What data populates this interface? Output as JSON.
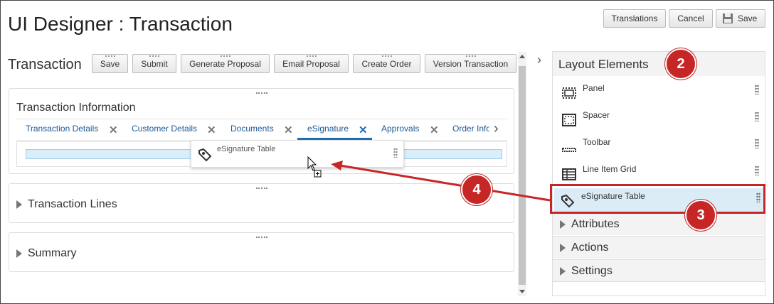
{
  "app": {
    "title": "UI Designer : Transaction"
  },
  "header_buttons": {
    "translations": "Translations",
    "cancel": "Cancel",
    "save": "Save"
  },
  "canvas": {
    "heading": "Transaction",
    "toolbar": [
      "Save",
      "Submit",
      "Generate Proposal",
      "Email Proposal",
      "Create Order",
      "Version Transaction"
    ]
  },
  "transaction_info": {
    "title": "Transaction Information",
    "tabs": [
      "Transaction Details",
      "Customer Details",
      "Documents",
      "eSignature",
      "Approvals",
      "Order Info"
    ],
    "active_tab": "eSignature"
  },
  "drag_ghost": {
    "label": "eSignature Table"
  },
  "sections": {
    "lines": "Transaction Lines",
    "summary": "Summary"
  },
  "layout_elements": {
    "title": "Layout Elements",
    "items": [
      "Panel",
      "Spacer",
      "Toolbar",
      "Line Item Grid",
      "eSignature Table"
    ],
    "selected": "eSignature Table"
  },
  "accordions": [
    "Attributes",
    "Actions",
    "Settings"
  ],
  "callouts": [
    "2",
    "3",
    "4"
  ],
  "colors": {
    "callout": "#c62626",
    "link": "#1e5a96",
    "active_tab_underline": "#1e6fb6",
    "drop_highlight": "#d9eef9"
  }
}
